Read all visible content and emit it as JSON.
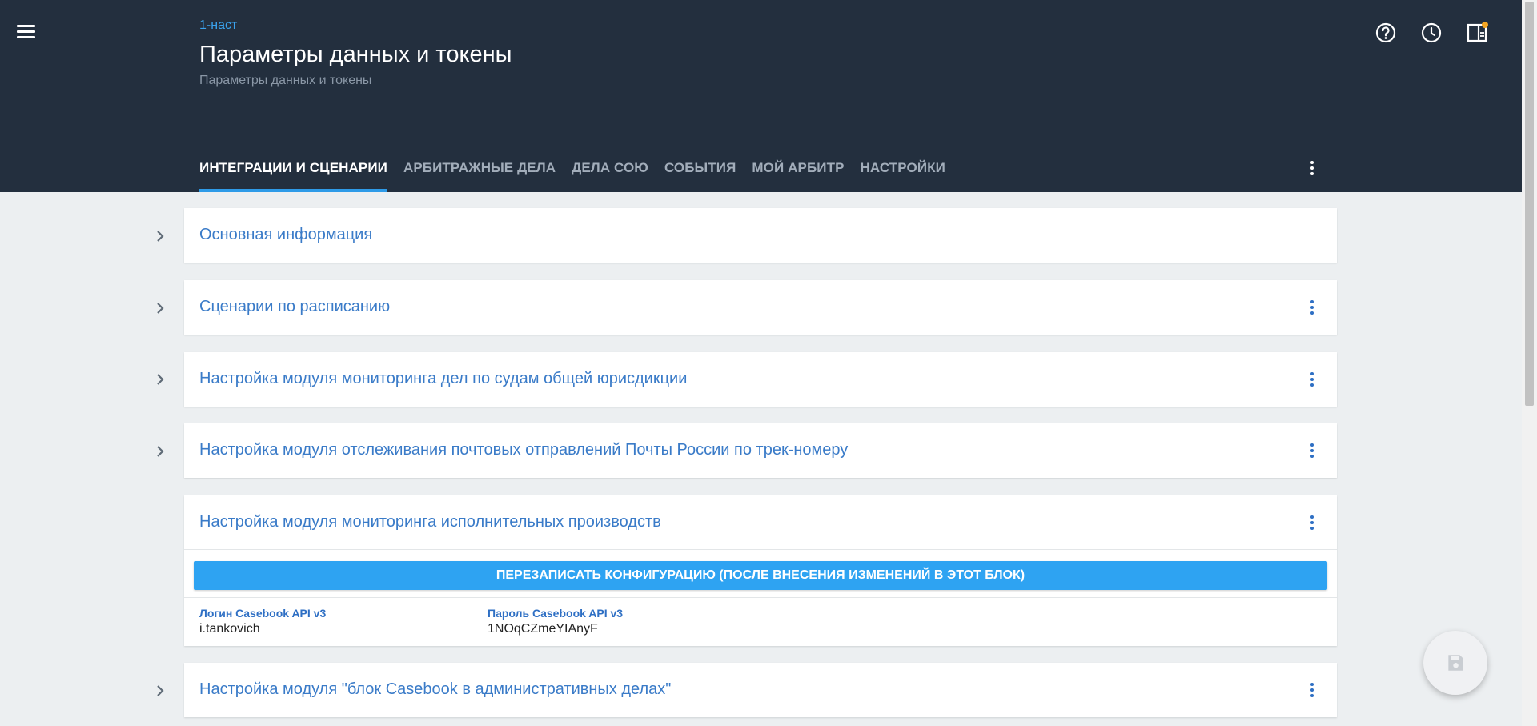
{
  "header": {
    "breadcrumb": "1-наст",
    "title": "Параметры данных и токены",
    "subtitle": "Параметры данных и токены",
    "icons": [
      "help-icon",
      "history-icon",
      "panel-icon"
    ],
    "tabs": [
      {
        "label": "ИНТЕГРАЦИИ И СЦЕНАРИИ",
        "active": true
      },
      {
        "label": "АРБИТРАЖНЫЕ ДЕЛА",
        "active": false
      },
      {
        "label": "ДЕЛА СОЮ",
        "active": false
      },
      {
        "label": "СОБЫТИЯ",
        "active": false
      },
      {
        "label": "МОЙ АРБИТР",
        "active": false
      },
      {
        "label": "НАСТРОЙКИ",
        "active": false
      }
    ]
  },
  "panels": [
    {
      "title": "Основная информация"
    },
    {
      "title": "Сценарии по расписанию"
    },
    {
      "title": "Настройка модуля мониторинга дел по судам общей юрисдикции"
    },
    {
      "title": "Настройка модуля отслеживания почтовых отправлений Почты России по трек-номеру"
    },
    {
      "title": "Настройка модуля мониторинга исполнительных производств"
    },
    {
      "title": "Настройка модуля \"блок Casebook в административных делах\""
    }
  ],
  "expanded_panel": {
    "rewrite_button": "ПЕРЕЗАПИСАТЬ КОНФИГУРАЦИЮ (ПОСЛЕ ВНЕСЕНИЯ ИЗМЕНЕНИЙ В ЭТОТ БЛОК)",
    "fields": [
      {
        "label": "Логин Casebook API v3",
        "value": "i.tankovich"
      },
      {
        "label": "Пароль Casebook API v3",
        "value": "1NOqCZmeYIAnyF"
      }
    ]
  },
  "colors": {
    "header_bg": "#232f3e",
    "accent": "#2e9be8",
    "link": "#3a7bc8",
    "notification": "#f5a623"
  }
}
